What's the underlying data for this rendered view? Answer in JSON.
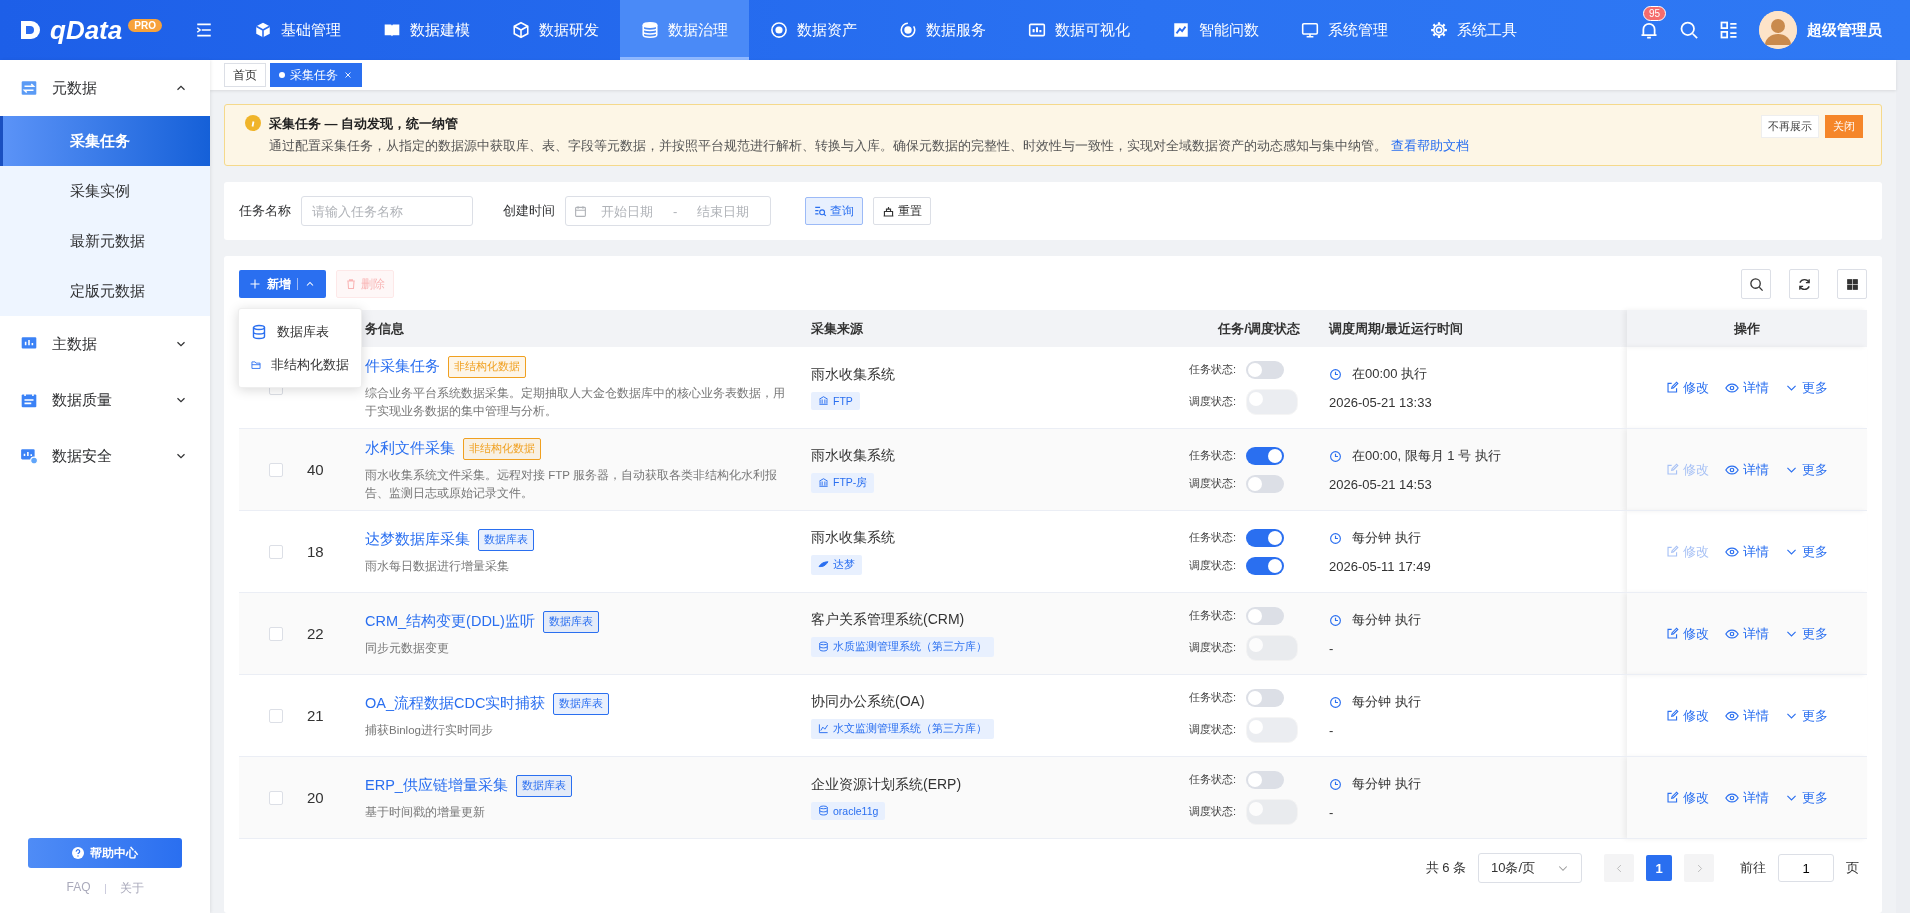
{
  "brand": {
    "name": "qData",
    "badge": "PRO"
  },
  "nav": [
    {
      "label": "基础管理",
      "selected": false
    },
    {
      "label": "数据建模",
      "selected": false
    },
    {
      "label": "数据研发",
      "selected": false
    },
    {
      "label": "数据治理",
      "selected": true
    },
    {
      "label": "数据资产",
      "selected": false
    },
    {
      "label": "数据服务",
      "selected": false
    },
    {
      "label": "数据可视化",
      "selected": false
    },
    {
      "label": "智能问数",
      "selected": false
    },
    {
      "label": "系统管理",
      "selected": false
    },
    {
      "label": "系统工具",
      "selected": false
    }
  ],
  "notifications": {
    "count": "95"
  },
  "user": {
    "name": "超级管理员"
  },
  "sidebar": {
    "groups": [
      {
        "label": "元数据",
        "expanded": true,
        "children": [
          {
            "label": "采集任务",
            "selected": true
          },
          {
            "label": "采集实例",
            "selected": false
          },
          {
            "label": "最新元数据",
            "selected": false
          },
          {
            "label": "定版元数据",
            "selected": false
          }
        ]
      },
      {
        "label": "主数据",
        "expanded": false
      },
      {
        "label": "数据质量",
        "expanded": false
      },
      {
        "label": "数据安全",
        "expanded": false
      }
    ],
    "help_button": "帮助中心",
    "links": [
      "FAQ",
      "关于"
    ]
  },
  "page_tabs": [
    {
      "label": "首页",
      "selected": false,
      "closable": false
    },
    {
      "label": "采集任务",
      "selected": true,
      "closable": true
    }
  ],
  "notice": {
    "title": "采集任务 — 自动发现，统一纳管",
    "text": "通过配置采集任务，从指定的数据源中获取库、表、字段等元数据，并按照平台规范进行解析、转换与入库。确保元数据的完整性、时效性与一致性，实现对全域数据资产的动态感知与集中纳管。",
    "link": "查看帮助文档",
    "dismiss": "不再展示",
    "close": "关闭"
  },
  "filters": {
    "task_name": {
      "label": "任务名称",
      "placeholder": "请输入任务名称"
    },
    "created": {
      "label": "创建时间",
      "start_placeholder": "开始日期",
      "separator": "-",
      "end_placeholder": "结束日期"
    },
    "search_button": "查询",
    "reset_button": "重置"
  },
  "toolbar": {
    "add_button": "新增",
    "delete_button": "删除",
    "delete_disabled": true
  },
  "add_menu": {
    "open": true,
    "items": [
      {
        "label": "数据库表"
      },
      {
        "label": "非结构化数据"
      }
    ]
  },
  "table": {
    "columns": [
      {
        "label": "务信息"
      },
      {
        "label": "采集来源"
      },
      {
        "label": "任务/调度状态"
      },
      {
        "label": "调度周期/最近运行时间"
      },
      {
        "label": "操作"
      }
    ],
    "rows": [
      {
        "checked": false,
        "title": "件采集任务",
        "tag": {
          "label": "非结构化数据",
          "color": "#f0a020"
        },
        "description": "综合业务平台系统数据采集。定期抽取人大金仓数据库中的核心业务表数据，用于实现业务数据的集中管理与分析。",
        "source": "雨水收集系统",
        "datasource": "FTP",
        "task_label": "任务状态:",
        "task_on": false,
        "schedule_label": "调度状态:",
        "schedule_on": false,
        "schedule_disabled": true,
        "cycle": "在00:00 执行",
        "last_run": "2026-05-21 13:33",
        "edit": "修改",
        "edit_disabled": false,
        "detail": "详情",
        "more": "更多"
      },
      {
        "checked": false,
        "id": "40",
        "title": "水利文件采集",
        "tag": {
          "label": "非结构化数据",
          "color": "#f0a020"
        },
        "description": "雨水收集系统文件采集。远程对接 FTP 服务器，自动获取各类非结构化水利报告、监测日志或原始记录文件。",
        "source": "雨水收集系统",
        "datasource": "FTP-房",
        "task_label": "任务状态:",
        "task_on": true,
        "schedule_label": "调度状态:",
        "schedule_on": false,
        "schedule_disabled": false,
        "cycle": "在00:00, 限每月 1 号 执行",
        "last_run": "2026-05-21 14:53",
        "edit": "修改",
        "edit_disabled": true,
        "detail": "详情",
        "more": "更多"
      },
      {
        "checked": false,
        "id": "18",
        "title": "达梦数据库采集",
        "tag": {
          "label": "数据库表",
          "color": "#2a6ff0"
        },
        "description": "雨水每日数据进行增量采集",
        "source": "雨水收集系统",
        "datasource": "达梦",
        "task_label": "任务状态:",
        "task_on": true,
        "schedule_label": "调度状态:",
        "schedule_on": true,
        "schedule_disabled": false,
        "cycle": "每分钟 执行",
        "last_run": "2026-05-11 17:49",
        "edit": "修改",
        "edit_disabled": true,
        "detail": "详情",
        "more": "更多"
      },
      {
        "checked": false,
        "id": "22",
        "title": "CRM_结构变更(DDL)监听",
        "tag": {
          "label": "数据库表",
          "color": "#2a6ff0"
        },
        "description": "同步元数据变更",
        "source": "客户关系管理系统(CRM)",
        "datasource": "水质监测管理系统（第三方库）",
        "task_label": "任务状态:",
        "task_on": false,
        "schedule_label": "调度状态:",
        "schedule_on": false,
        "schedule_disabled": true,
        "cycle": "每分钟 执行",
        "last_run": "-",
        "edit": "修改",
        "edit_disabled": false,
        "detail": "详情",
        "more": "更多"
      },
      {
        "checked": false,
        "id": "21",
        "title": "OA_流程数据CDC实时捕获",
        "tag": {
          "label": "数据库表",
          "color": "#2a6ff0"
        },
        "description": "捕获Binlog进行实时同步",
        "source": "协同办公系统(OA)",
        "datasource": "水文监测管理系统（第三方库）",
        "task_label": "任务状态:",
        "task_on": false,
        "schedule_label": "调度状态:",
        "schedule_on": false,
        "schedule_disabled": true,
        "cycle": "每分钟 执行",
        "last_run": "-",
        "edit": "修改",
        "edit_disabled": false,
        "detail": "详情",
        "more": "更多"
      },
      {
        "checked": false,
        "id": "20",
        "title": "ERP_供应链增量采集",
        "tag": {
          "label": "数据库表",
          "color": "#2a6ff0"
        },
        "description": "基于时间戳的增量更新",
        "source": "企业资源计划系统(ERP)",
        "datasource": "oracle11g",
        "task_label": "任务状态:",
        "task_on": false,
        "schedule_label": "调度状态:",
        "schedule_on": false,
        "schedule_disabled": true,
        "cycle": "每分钟 执行",
        "last_run": "-",
        "edit": "修改",
        "edit_disabled": false,
        "detail": "详情",
        "more": "更多"
      }
    ]
  },
  "pagination": {
    "total": "共 6 条",
    "page_size": "10条/页",
    "pages": [
      {
        "label": "1",
        "selected": true
      }
    ],
    "goto_label": "前往",
    "goto_value": "1",
    "goto_unit": "页"
  }
}
